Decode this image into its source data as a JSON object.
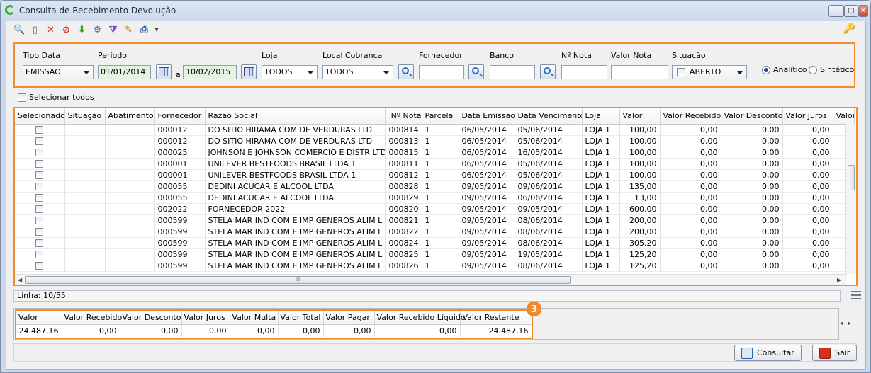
{
  "window": {
    "title": "Consulta de Recebimento Devolução",
    "min": "–",
    "max": "▢",
    "close": "✕"
  },
  "toolbar": {
    "tools": [
      {
        "name": "search-icon",
        "glyph": "🔍",
        "color": "#2a62a8"
      },
      {
        "name": "new-document-icon",
        "glyph": "▯",
        "color": "#666"
      },
      {
        "name": "delete-icon",
        "glyph": "✕",
        "color": "#d62a1e"
      },
      {
        "name": "cancel-icon",
        "glyph": "⊘",
        "color": "#d62a1e"
      },
      {
        "name": "download-arrow-icon",
        "glyph": "⬇",
        "color": "#3a9a2a"
      },
      {
        "name": "tools-icon",
        "glyph": "⚙",
        "color": "#3d6fa8"
      },
      {
        "name": "filter-icon",
        "glyph": "⧩",
        "color": "#7a4fc6"
      },
      {
        "name": "edit-icon",
        "glyph": "✎",
        "color": "#c47a14"
      },
      {
        "name": "print-icon",
        "glyph": "⎙",
        "color": "#2a62a8"
      },
      {
        "name": "dropdown-arrow-icon",
        "glyph": "▾",
        "color": "#444"
      }
    ],
    "key_glyph": "🔑"
  },
  "filters": {
    "tipo_data": {
      "label": "Tipo Data",
      "value": "EMISSAO"
    },
    "periodo": {
      "label": "Período",
      "from": "01/01/2014",
      "sep": "a",
      "to": "10/02/2015"
    },
    "loja": {
      "label": "Loja",
      "value": "TODOS"
    },
    "local_cobranca": {
      "label": "Local Cobranca",
      "value": "TODOS"
    },
    "fornecedor": {
      "label": "Fornecedor",
      "value": ""
    },
    "banco": {
      "label": "Banco",
      "value": ""
    },
    "nota": {
      "label": "Nº Nota",
      "value": ""
    },
    "valor_nota": {
      "label": "Valor Nota",
      "value": ""
    },
    "situacao": {
      "label": "Situação",
      "value": "ABERTO"
    },
    "analitico": "Analítico",
    "sintetico": "Sintético"
  },
  "select_all": "Selecionar todos",
  "grid": {
    "columns": [
      "Selecionado",
      "Situação",
      "Abatimento",
      "Fornecedor",
      "Razão Social",
      "Nº Nota",
      "Parcela",
      "Data Emissão",
      "Data Vencimento",
      "Loja",
      "Valor",
      "Valor Recebido",
      "Valor Desconto",
      "Valor Juros",
      "Valor"
    ],
    "rows": [
      [
        "",
        "",
        "",
        "000012",
        "DO SITIO HIRAMA COM DE VERDURAS LTD",
        "000814",
        "1",
        "06/05/2014",
        "05/06/2014",
        "LOJA 1",
        "100,00",
        "0,00",
        "0,00",
        "0,00"
      ],
      [
        "",
        "",
        "",
        "000012",
        "DO SITIO HIRAMA COM DE VERDURAS LTD",
        "000813",
        "1",
        "06/05/2014",
        "05/06/2014",
        "LOJA 1",
        "100,00",
        "0,00",
        "0,00",
        "0,00"
      ],
      [
        "",
        "",
        "",
        "000025",
        "JOHNSON E JOHNSON COMERCIO E DISTR LTD",
        "000815",
        "1",
        "06/05/2014",
        "16/05/2014",
        "LOJA 1",
        "100,00",
        "0,00",
        "0,00",
        "0,00"
      ],
      [
        "",
        "",
        "",
        "000001",
        "UNILEVER BESTFOODS BRASIL LTDA 1",
        "000811",
        "1",
        "06/05/2014",
        "05/06/2014",
        "LOJA 1",
        "100,00",
        "0,00",
        "0,00",
        "0,00"
      ],
      [
        "",
        "",
        "",
        "000001",
        "UNILEVER BESTFOODS BRASIL LTDA 1",
        "000812",
        "1",
        "06/05/2014",
        "05/06/2014",
        "LOJA 1",
        "100,00",
        "0,00",
        "0,00",
        "0,00"
      ],
      [
        "",
        "",
        "",
        "000055",
        "DEDINI ACUCAR E ALCOOL LTDA",
        "000828",
        "1",
        "09/05/2014",
        "09/06/2014",
        "LOJA 1",
        "135,00",
        "0,00",
        "0,00",
        "0,00"
      ],
      [
        "",
        "",
        "",
        "000055",
        "DEDINI ACUCAR E ALCOOL LTDA",
        "000829",
        "1",
        "09/05/2014",
        "06/06/2014",
        "LOJA 1",
        "13,00",
        "0,00",
        "0,00",
        "0,00"
      ],
      [
        "",
        "",
        "",
        "002022",
        "FORNECEDOR 2022",
        "000820",
        "1",
        "09/05/2014",
        "09/05/2014",
        "LOJA 1",
        "600,00",
        "0,00",
        "0,00",
        "0,00"
      ],
      [
        "",
        "",
        "",
        "000599",
        "STELA MAR IND COM E IMP GENEROS ALIM L",
        "000821",
        "1",
        "09/05/2014",
        "08/06/2014",
        "LOJA 1",
        "200,00",
        "0,00",
        "0,00",
        "0,00"
      ],
      [
        "",
        "",
        "",
        "000599",
        "STELA MAR IND COM E IMP GENEROS ALIM L",
        "000822",
        "1",
        "09/05/2014",
        "08/06/2014",
        "LOJA 1",
        "200,00",
        "0,00",
        "0,00",
        "0,00"
      ],
      [
        "",
        "",
        "",
        "000599",
        "STELA MAR IND COM E IMP GENEROS ALIM L",
        "000824",
        "1",
        "09/05/2014",
        "08/06/2014",
        "LOJA 1",
        "305,20",
        "0,00",
        "0,00",
        "0,00"
      ],
      [
        "",
        "",
        "",
        "000599",
        "STELA MAR IND COM E IMP GENEROS ALIM L",
        "000825",
        "1",
        "09/05/2014",
        "19/05/2014",
        "LOJA 1",
        "125,20",
        "0,00",
        "0,00",
        "0,00"
      ],
      [
        "",
        "",
        "",
        "000599",
        "STELA MAR IND COM E IMP GENEROS ALIM L",
        "000826",
        "1",
        "09/05/2014",
        "08/06/2014",
        "LOJA 1",
        "125,20",
        "0,00",
        "0,00",
        "0,00"
      ]
    ],
    "hscroll_grip": "III"
  },
  "linha": "Linha: 10/55",
  "totals": {
    "columns": [
      "Valor",
      "Valor Recebido",
      "Valor Desconto",
      "Valor Juros",
      "Valor Multa",
      "Valor Total",
      "Valor Pagar",
      "Valor Recebido Líquido",
      "Valor Restante"
    ],
    "values": [
      "24.487,16",
      "0,00",
      "0,00",
      "0,00",
      "0,00",
      "0,00",
      "0,00",
      "0,00",
      "24.487,16"
    ],
    "badge": "3"
  },
  "buttons": {
    "consultar": "Consultar",
    "sair": "Sair"
  },
  "colors": {
    "highlight": "#f08c2e"
  }
}
